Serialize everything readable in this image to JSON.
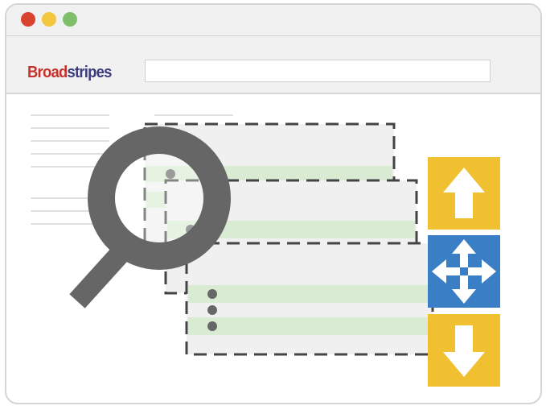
{
  "window": {
    "controls": [
      "close",
      "minimize",
      "maximize"
    ],
    "control_colors": {
      "close": "#d9432f",
      "minimize": "#f4c53f",
      "maximize": "#7fbf6a"
    }
  },
  "header": {
    "logo": {
      "part1": "Broad",
      "part2": "stripes",
      "color1": "#c8312b",
      "color2": "#3b3b7d"
    },
    "address_value": ""
  },
  "icons": [
    "magnifier-icon",
    "arrow-up-icon",
    "move-icon",
    "arrow-down-icon"
  ],
  "colors": {
    "arrow_panel": "#f0c030",
    "move_panel": "#3a7ec6",
    "magnifier": "#666666",
    "row_highlight": "#d9ecd3",
    "card_fill": "#f0f0f0"
  }
}
